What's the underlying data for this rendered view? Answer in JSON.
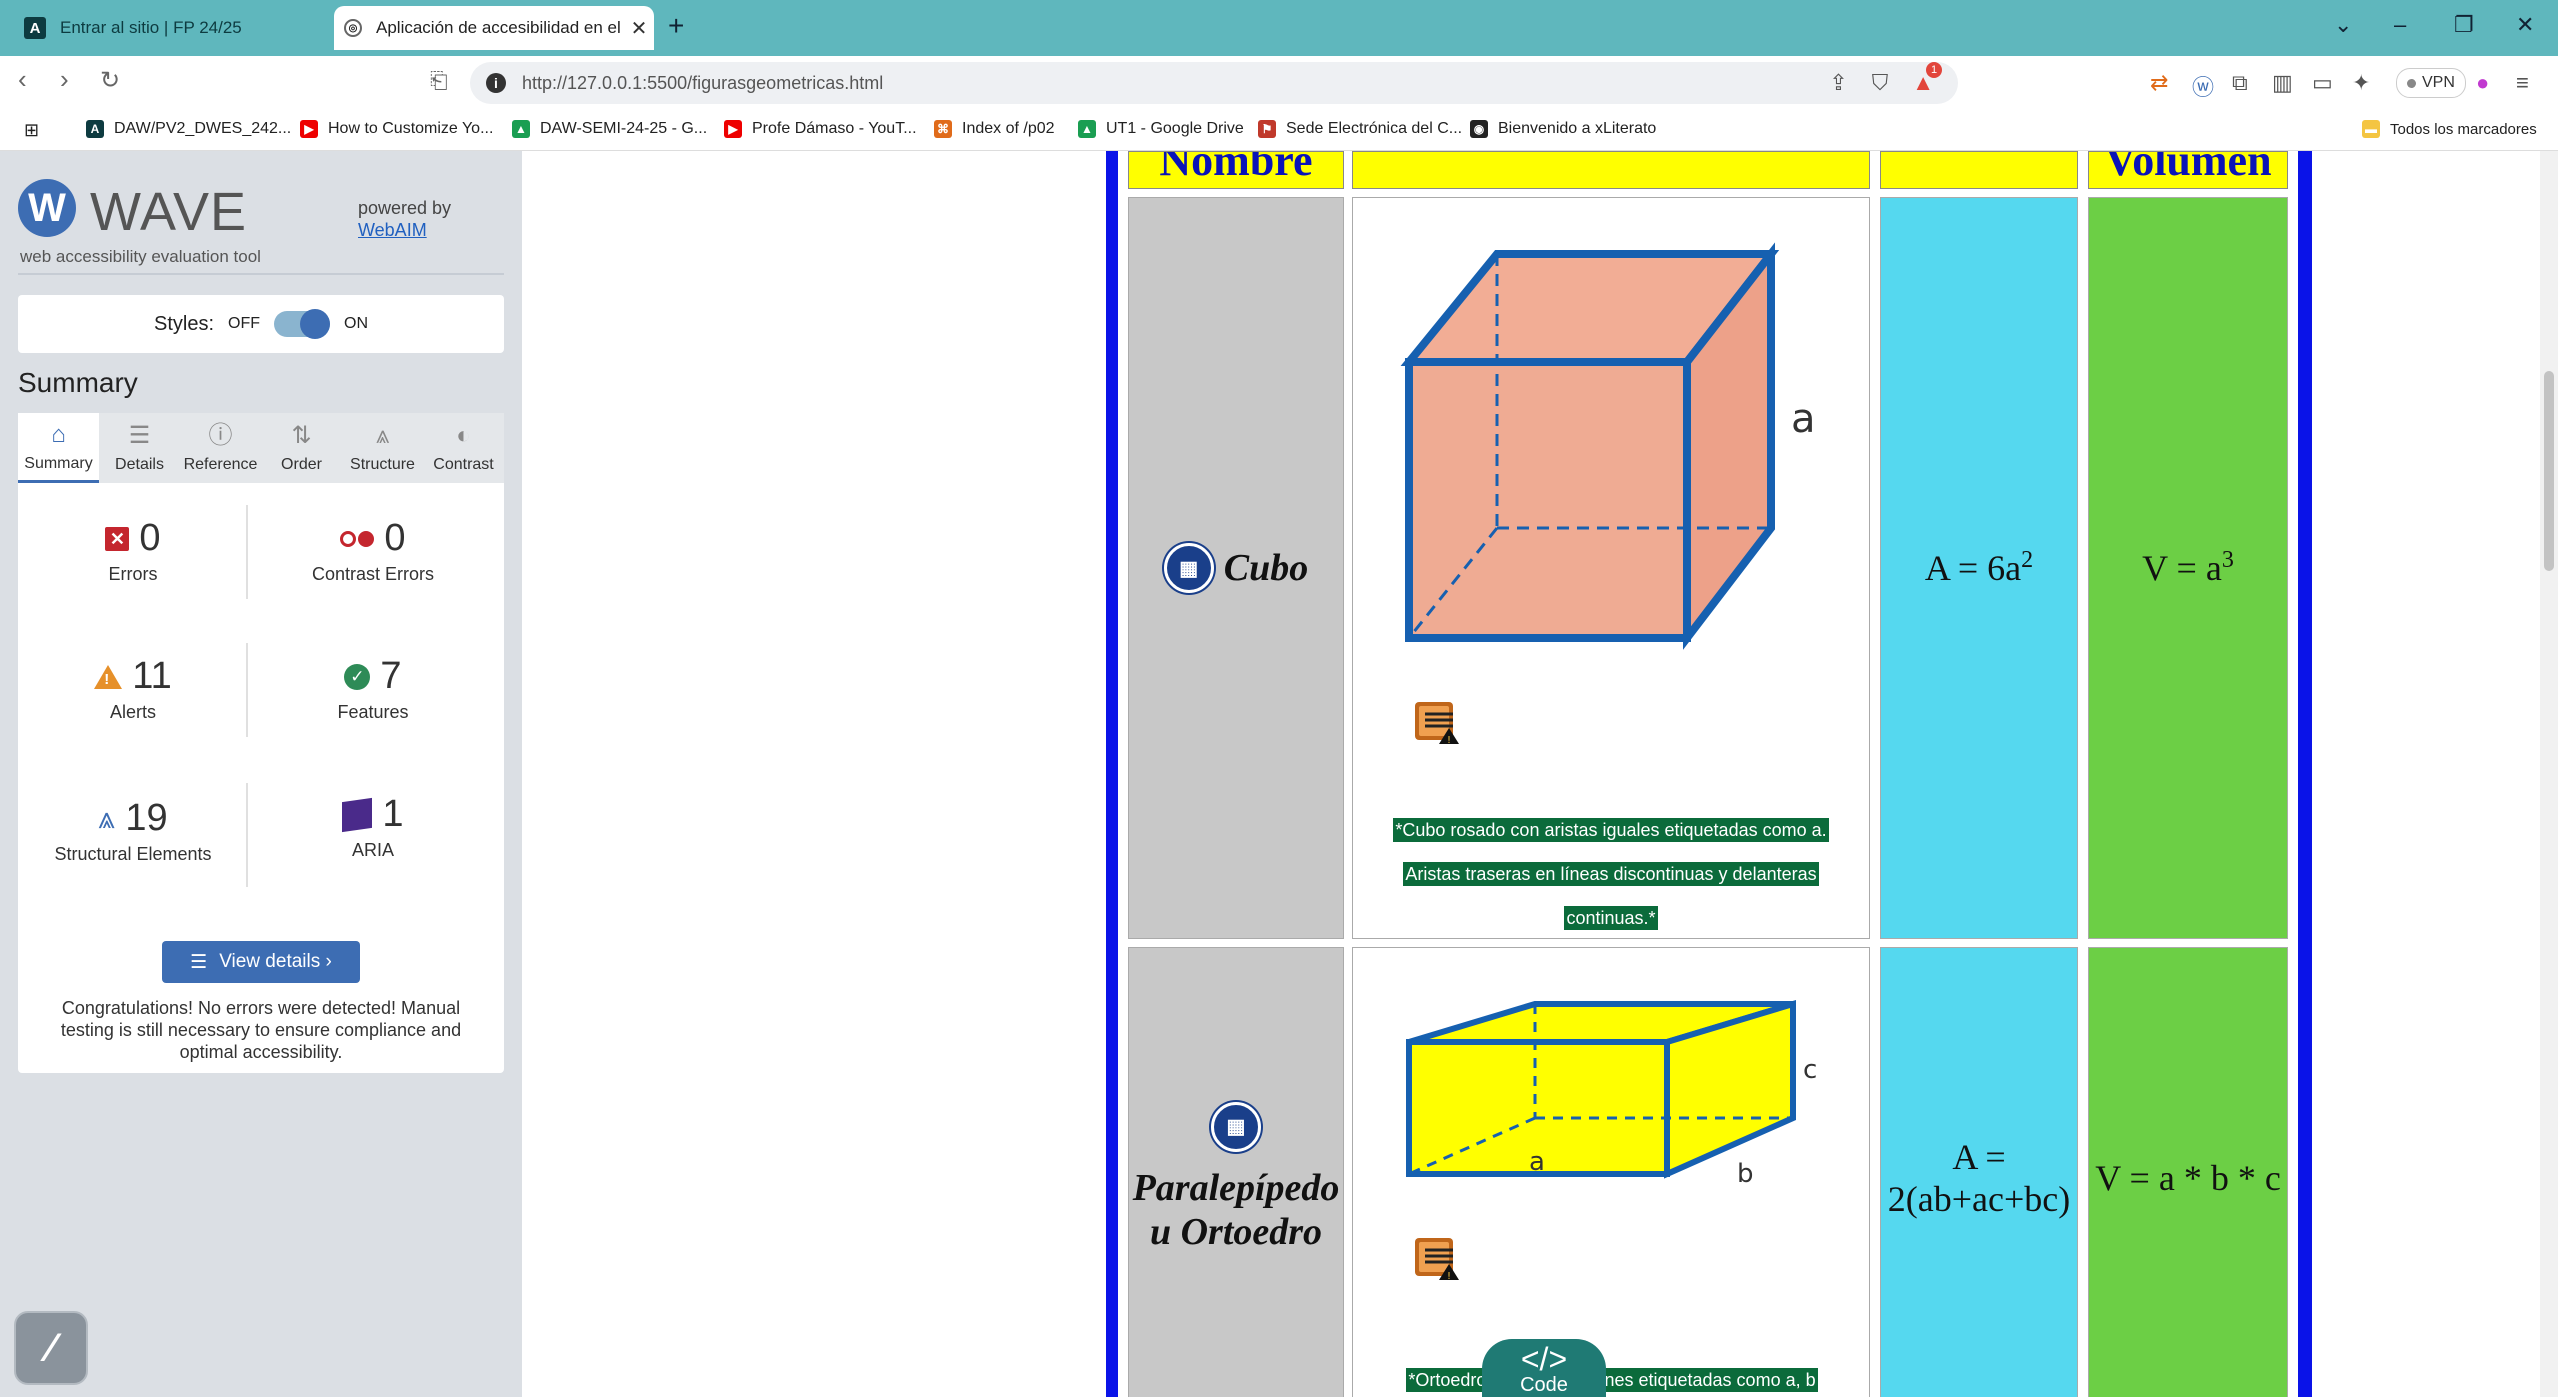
{
  "browser": {
    "tabs": [
      {
        "title": "Entrar al sitio | FP 24/25",
        "icon": "moodle-a-icon"
      },
      {
        "title": "Aplicación de accesibilidad en el u",
        "icon": "globe-icon"
      }
    ],
    "url": "http://127.0.0.1:5500/figurasgeometricas.html",
    "shield_count": "1",
    "vpn_label": "VPN",
    "bookmarks": [
      {
        "label": "DAW/PV2_DWES_242...",
        "color": "#0d3b40",
        "glyph": "A"
      },
      {
        "label": "How to Customize Yo...",
        "color": "#e00",
        "glyph": "▶"
      },
      {
        "label": "DAW-SEMI-24-25 - G...",
        "color": "#1a9e52",
        "glyph": "▲"
      },
      {
        "label": "Profe Dámaso - YouT...",
        "color": "#e00",
        "glyph": "▶"
      },
      {
        "label": "Index of /p02",
        "color": "#e06b1a",
        "glyph": "⌘"
      },
      {
        "label": "UT1 - Google Drive",
        "color": "#1a9e52",
        "glyph": "▲"
      },
      {
        "label": "Sede Electrónica del C...",
        "color": "#c0392b",
        "glyph": "⚑"
      },
      {
        "label": "Bienvenido a xLiterato",
        "color": "#222",
        "glyph": "◉"
      }
    ],
    "all_bookmarks": "Todos los marcadores"
  },
  "wave": {
    "logo_letter": "W",
    "logo_text": "WAVE",
    "tagline": "web accessibility evaluation tool",
    "powered_by": "powered by",
    "powered_link": "WebAIM",
    "styles_label": "Styles:",
    "styles_off": "OFF",
    "styles_on": "ON",
    "summary_heading": "Summary",
    "tabs": [
      {
        "label": "Summary",
        "icon": "home-icon",
        "glyph": "⌂"
      },
      {
        "label": "Details",
        "icon": "list-icon",
        "glyph": "☰"
      },
      {
        "label": "Reference",
        "icon": "info-icon",
        "glyph": "ⓘ"
      },
      {
        "label": "Order",
        "icon": "order-icon",
        "glyph": "⇅"
      },
      {
        "label": "Structure",
        "icon": "structure-icon",
        "glyph": "⩓"
      },
      {
        "label": "Contrast",
        "icon": "contrast-icon",
        "glyph": "◐"
      }
    ],
    "stats": {
      "errors": {
        "count": "0",
        "label": "Errors"
      },
      "contrast_errors": {
        "count": "0",
        "label": "Contrast Errors"
      },
      "alerts": {
        "count": "11",
        "label": "Alerts"
      },
      "features": {
        "count": "7",
        "label": "Features"
      },
      "structural": {
        "count": "19",
        "label": "Structural Elements"
      },
      "aria": {
        "count": "1",
        "label": "ARIA"
      }
    },
    "view_details": "View details ›",
    "congrats": "Congratulations! No errors were detected! Manual testing is still necessary to ensure compliance and optimal accessibility.",
    "colors": {
      "accent": "#3d6db3",
      "error": "#c4262e",
      "alert": "#e6902a",
      "feature": "#2e8b57",
      "aria": "#4a2a8a"
    }
  },
  "content": {
    "header": {
      "name": "Nombre",
      "volume": "Volumen"
    },
    "rows": [
      {
        "name": "Cubo",
        "area": "A = 6a",
        "area_sup": "2",
        "volume": "V = a",
        "volume_sup": "3",
        "edge_label": "a",
        "alt_text": "*Cubo rosado con aristas iguales etiquetadas como a. Aristas traseras en líneas discontinuas y delanteras continuas.*"
      },
      {
        "name": "Paralepípedo u Ortoedro",
        "area": "A = 2(ab+ac+bc)",
        "volume": "V = a * b * c",
        "edge_labels": [
          "a",
          "b",
          "c"
        ],
        "alt_text": "*Ortoedro ama         nsiones etiquetadas como a, b"
      }
    ],
    "code_button": {
      "glyph": "</>",
      "label": "Code"
    },
    "colors": {
      "header_bg": "#ffff00",
      "border": "#0a13e8",
      "name_bg": "#c8c8c8",
      "area_bg": "#55d8ef",
      "volume_bg": "#6ccf45"
    }
  }
}
